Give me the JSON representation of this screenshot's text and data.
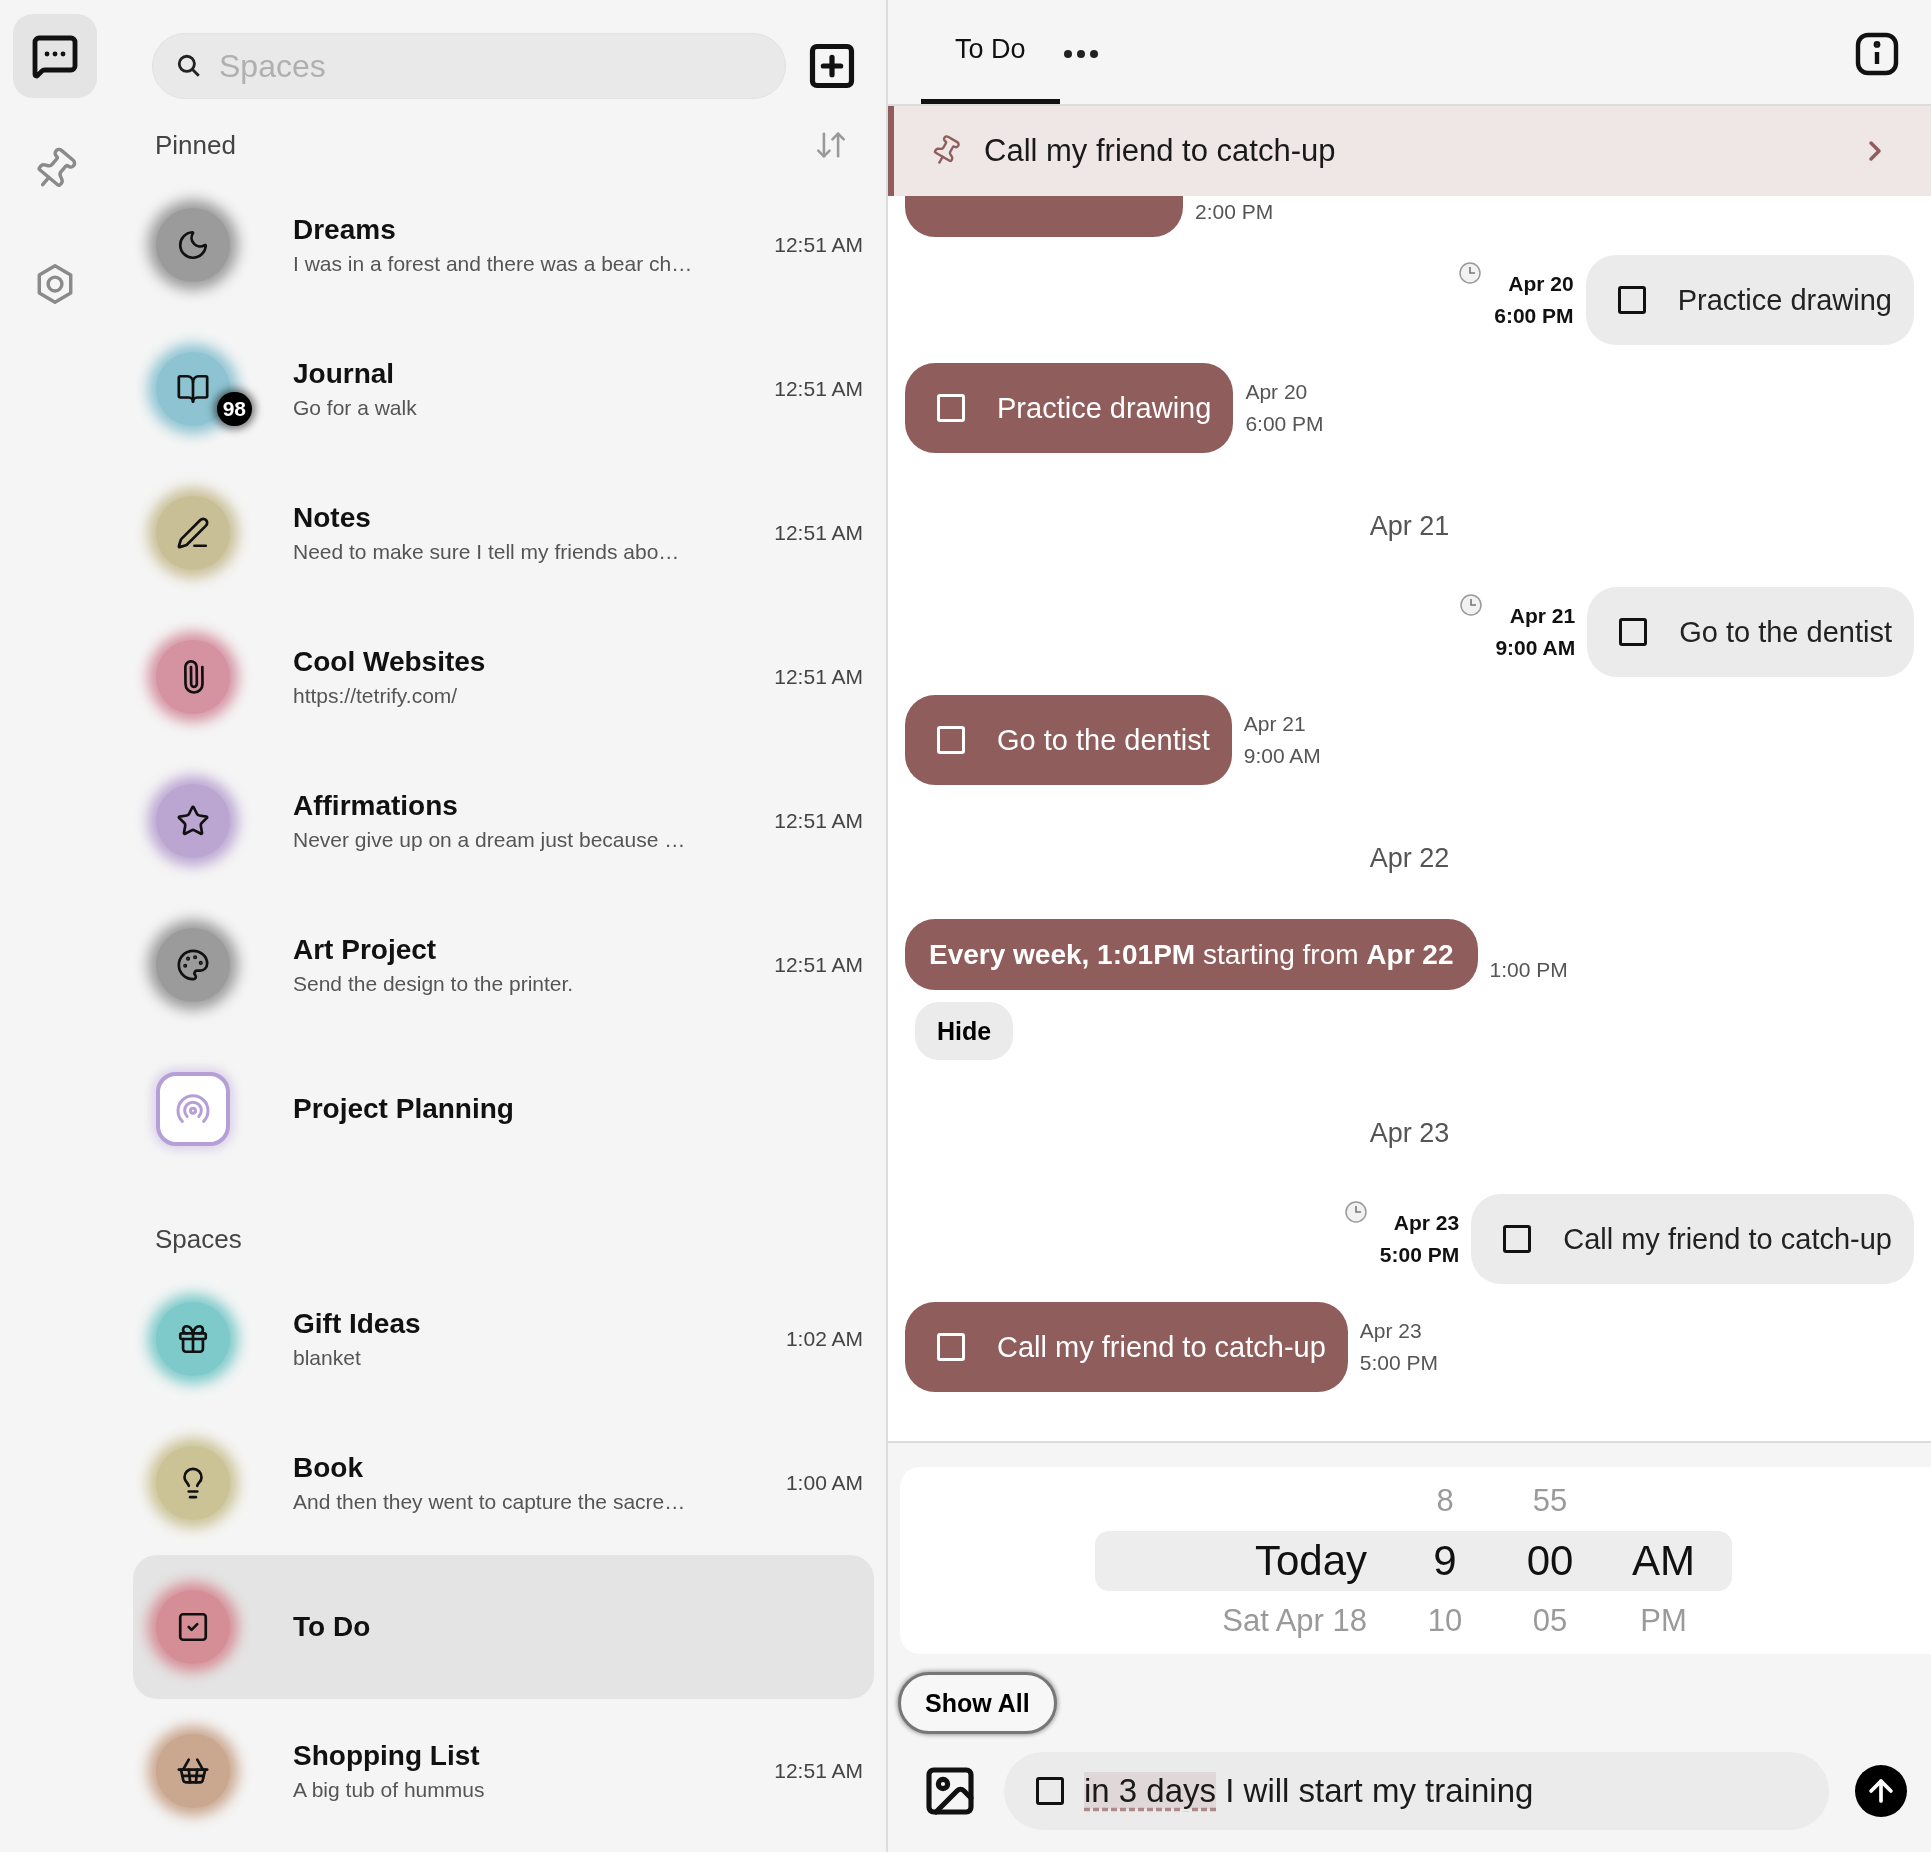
{
  "rail": {
    "items": [
      {
        "selected": true
      },
      {
        "selected": false
      },
      {
        "selected": false
      }
    ]
  },
  "search": {
    "placeholder": "Spaces"
  },
  "sections": [
    {
      "title": "Pinned",
      "sortable": true,
      "items": [
        {
          "title": "Dreams",
          "subtitle": "I was in a forest and there was a bear ch…",
          "time": "12:51 AM",
          "color": "#9b9b9b",
          "kind": "round",
          "selected": false
        },
        {
          "title": "Journal",
          "subtitle": "Go for a walk",
          "time": "12:51 AM",
          "badge": "98",
          "color": "#8ec4d2",
          "kind": "round",
          "selected": false
        },
        {
          "title": "Notes",
          "subtitle": "Need to make sure I tell my friends abo…",
          "time": "12:51 AM",
          "color": "#c9bf96",
          "kind": "round",
          "selected": false
        },
        {
          "title": "Cool Websites",
          "subtitle": "https://tetrify.com/",
          "time": "12:51 AM",
          "color": "#d592a1",
          "kind": "round",
          "selected": false
        },
        {
          "title": "Affirmations",
          "subtitle": "Never give up on a dream just because …",
          "time": "12:51 AM",
          "color": "#bba6d2",
          "kind": "round",
          "selected": false
        },
        {
          "title": "Art Project",
          "subtitle": "Send the design to the printer.",
          "time": "12:51 AM",
          "color": "#9b9b9b",
          "kind": "round",
          "selected": false
        },
        {
          "title": "Project Planning",
          "color": "#b59fd6",
          "kind": "square",
          "selected": false
        }
      ]
    },
    {
      "title": "Spaces",
      "sortable": false,
      "items": [
        {
          "title": "Gift Ideas",
          "subtitle": "blanket",
          "time": "1:02 AM",
          "color": "#7ecaca",
          "kind": "round",
          "selected": false
        },
        {
          "title": "Book",
          "subtitle": "And then they went to capture the sacre…",
          "time": "1:00 AM",
          "color": "#cbc396",
          "kind": "round",
          "selected": false
        },
        {
          "title": "To Do",
          "color": "#d68e96",
          "kind": "round",
          "selected": true
        },
        {
          "title": "Shopping List",
          "subtitle": "A big tub of hummus",
          "time": "12:51 AM",
          "color": "#caa78f",
          "kind": "round",
          "selected": false
        }
      ]
    }
  ],
  "conversation": {
    "tab": {
      "label": "To Do",
      "selected": true
    },
    "pinned": {
      "text": "Call my friend to catch-up"
    },
    "messages": [
      {
        "kind": "partial",
        "time": "2:00 PM"
      },
      {
        "kind": "scheduled",
        "text": "Practice drawing",
        "date": "Apr 20",
        "time": "6:00 PM",
        "checked": false
      },
      {
        "kind": "task",
        "text": "Practice drawing",
        "date": "Apr 20",
        "time": "6:00 PM",
        "checked": false
      },
      {
        "kind": "date",
        "text": "Apr 21"
      },
      {
        "kind": "scheduled",
        "text": "Go to the dentist",
        "date": "Apr 21",
        "time": "9:00 AM",
        "checked": false
      },
      {
        "kind": "task",
        "text": "Go to the dentist",
        "date": "Apr 21",
        "time": "9:00 AM",
        "checked": false
      },
      {
        "kind": "date",
        "text": "Apr 22"
      },
      {
        "kind": "recurrence",
        "text": "**Every week, 1:01PM** starting from **Apr 22**",
        "time": "1:00 PM"
      },
      {
        "kind": "action",
        "text": "Hide"
      },
      {
        "kind": "date",
        "text": "Apr 23"
      },
      {
        "kind": "scheduled",
        "text": "Call my friend to catch-up",
        "date": "Apr 23",
        "time": "5:00 PM",
        "checked": false
      },
      {
        "kind": "task",
        "text": "Call my friend to catch-up",
        "date": "Apr 23",
        "time": "5:00 PM",
        "checked": false
      }
    ],
    "picker": {
      "rows": [
        {
          "hour": "8",
          "minute": "55",
          "selected": false
        },
        {
          "day": "Today",
          "hour": "9",
          "minute": "00",
          "period": "AM",
          "selected": true
        },
        {
          "day": "Sat Apr 18",
          "hour": "10",
          "minute": "05",
          "period": "PM",
          "selected": false
        }
      ]
    },
    "show_all": "Show All",
    "composer": {
      "checked": false,
      "highlight": "in 3 days",
      "value": "I will start my training"
    }
  }
}
